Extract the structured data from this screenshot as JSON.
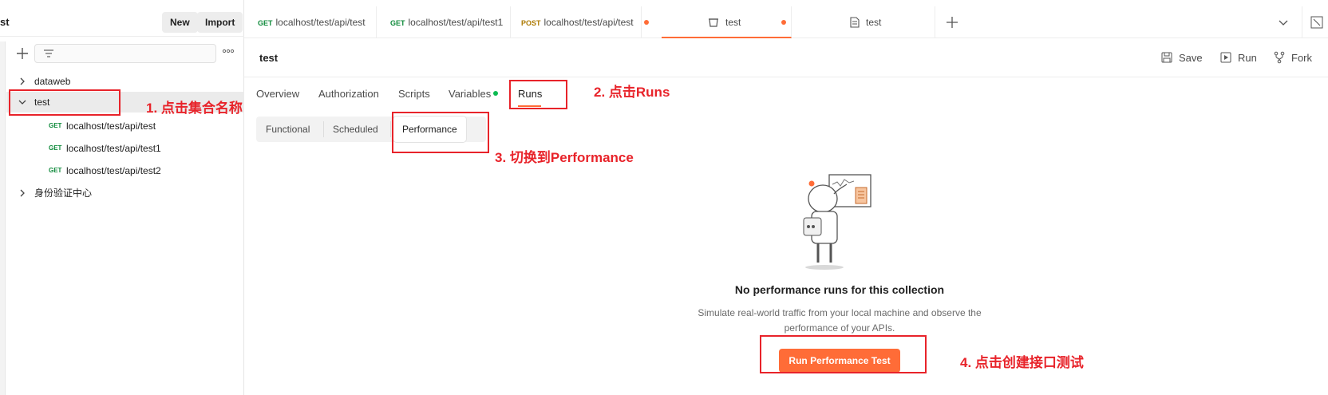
{
  "sidebar": {
    "workspace_title": "st",
    "new_label": "New",
    "import_label": "Import",
    "tree": [
      {
        "label": "dataweb",
        "expanded": false
      },
      {
        "label": "test",
        "expanded": true
      },
      {
        "label": "身份验证中心",
        "expanded": false
      }
    ],
    "requests": [
      {
        "method": "GET",
        "label": "localhost/test/api/test"
      },
      {
        "method": "GET",
        "label": "localhost/test/api/test1"
      },
      {
        "method": "GET",
        "label": "localhost/test/api/test2"
      }
    ]
  },
  "tabs": [
    {
      "method": "GET",
      "label": "localhost/test/api/test"
    },
    {
      "method": "GET",
      "label": "localhost/test/api/test1"
    },
    {
      "method": "POST",
      "label": "localhost/test/api/test"
    },
    {
      "label": "test"
    },
    {
      "label": "test"
    }
  ],
  "collection": {
    "title": "test",
    "save_label": "Save",
    "run_label": "Run",
    "fork_label": "Fork"
  },
  "subtabs": [
    "Overview",
    "Authorization",
    "Scripts",
    "Variables",
    "Runs"
  ],
  "segments": [
    "Functional",
    "Scheduled",
    "Performance"
  ],
  "empty_state": {
    "title": "No performance runs for this collection",
    "description": "Simulate real-world traffic from your local machine and observe the performance of your APIs.",
    "button_label": "Run Performance Test"
  },
  "annotations": {
    "step1": "1. 点击集合名称",
    "step2": "2. 点击Runs",
    "step3": "3. 切换到Performance",
    "step4": "4. 点击创建接口测试"
  },
  "colors": {
    "accent": "#ff6c37",
    "annotation": "#e8232a",
    "get_method": "#0f8a3b",
    "post_method": "#ad7a03",
    "variables_dot": "#0cbb52"
  }
}
